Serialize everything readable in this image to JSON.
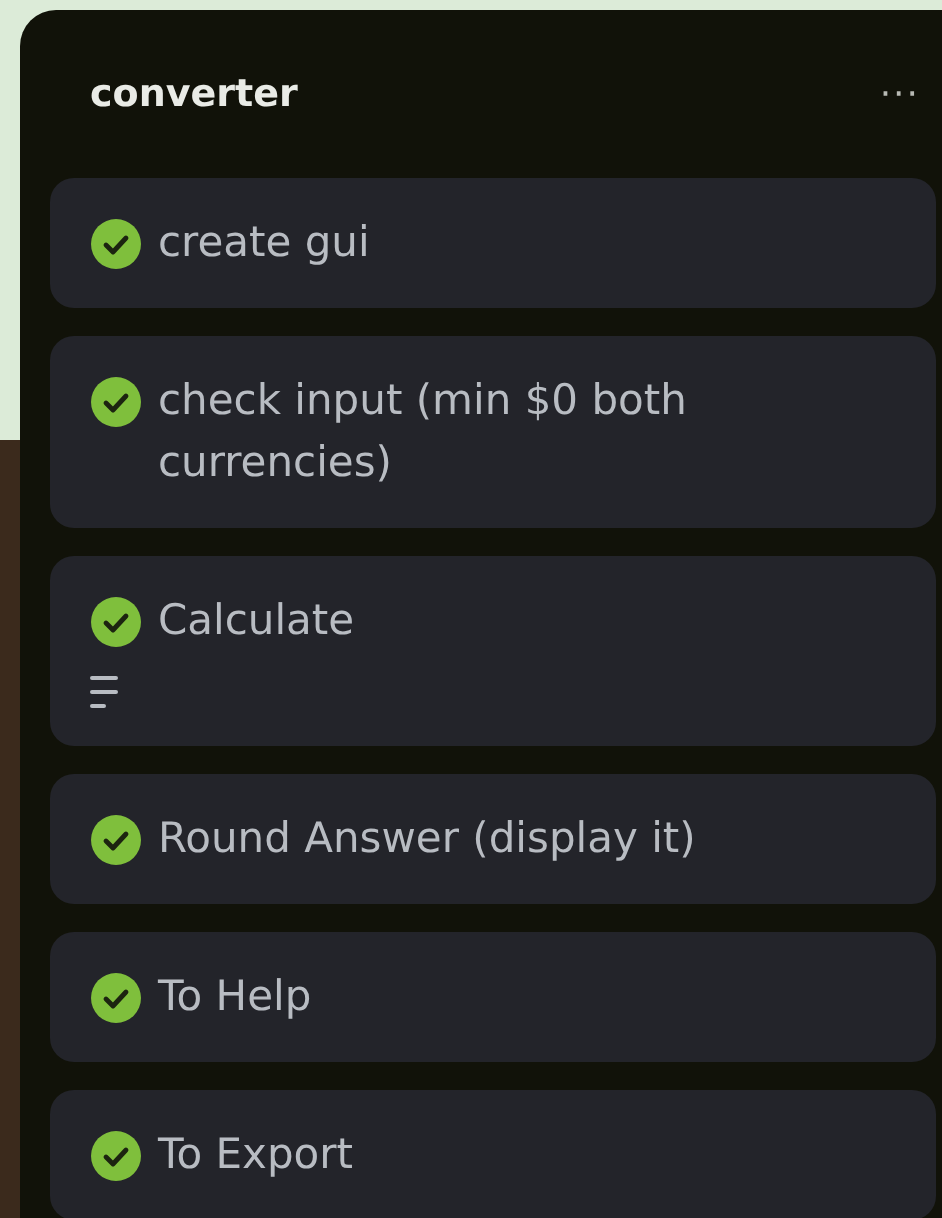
{
  "list": {
    "title": "converter",
    "menu": "···"
  },
  "cards": [
    {
      "title": "create gui",
      "complete": true,
      "has_description": false
    },
    {
      "title": "check input (min $0 both currencies)",
      "complete": true,
      "has_description": false
    },
    {
      "title": "Calculate",
      "complete": true,
      "has_description": true
    },
    {
      "title": "Round Answer (display it)",
      "complete": true,
      "has_description": false
    },
    {
      "title": "To Help",
      "complete": true,
      "has_description": false
    },
    {
      "title": "To Export",
      "complete": true,
      "has_description": false
    }
  ]
}
